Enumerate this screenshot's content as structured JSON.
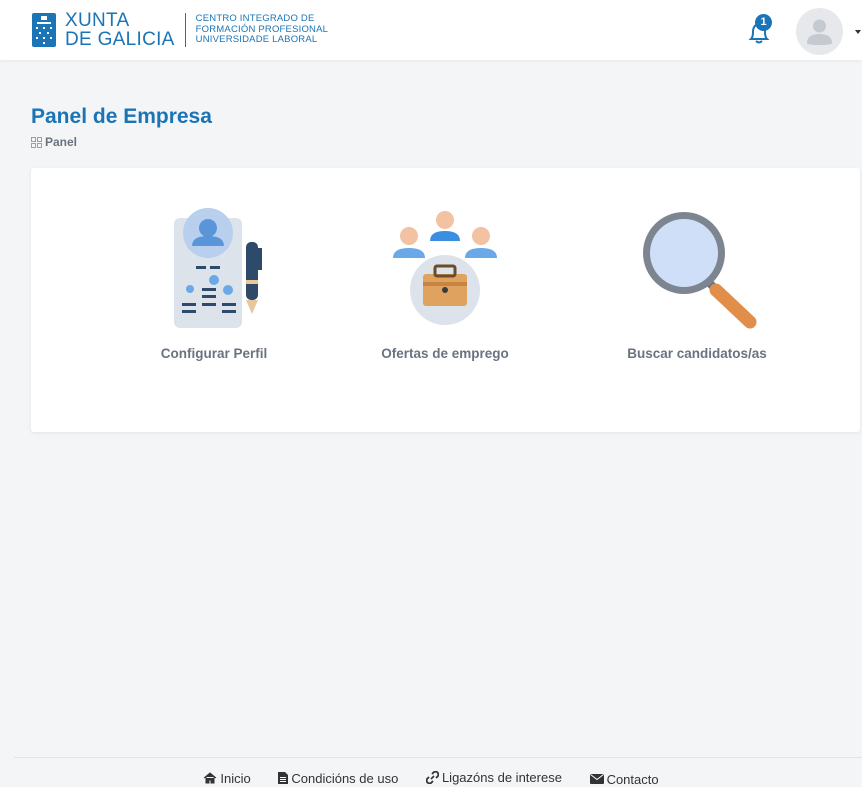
{
  "header": {
    "brand_line1": "XUNTA",
    "brand_line2": "DE GALICIA",
    "school_line1": "CENTRO INTEGRADO DE",
    "school_line2": "FORMACIÓN PROFESIONAL",
    "school_line3": "UNIVERSIDADE LABORAL",
    "notification_count": "1",
    "brand_color": "#1a74b6"
  },
  "page": {
    "title": "Panel de Empresa",
    "breadcrumb": "Panel"
  },
  "tiles": [
    {
      "label": "Configurar Perfil",
      "icon": "profile-document-icon"
    },
    {
      "label": "Ofertas de emprego",
      "icon": "job-offers-icon"
    },
    {
      "label": "Buscar candidatos/as",
      "icon": "magnifier-icon"
    }
  ],
  "footer": {
    "links": [
      {
        "label": "Inicio",
        "icon": "home-icon"
      },
      {
        "label": "Condicións de uso",
        "icon": "document-icon"
      },
      {
        "label": "Ligazóns de interese",
        "icon": "link-icon"
      },
      {
        "label": "Contacto",
        "icon": "envelope-icon"
      }
    ]
  }
}
